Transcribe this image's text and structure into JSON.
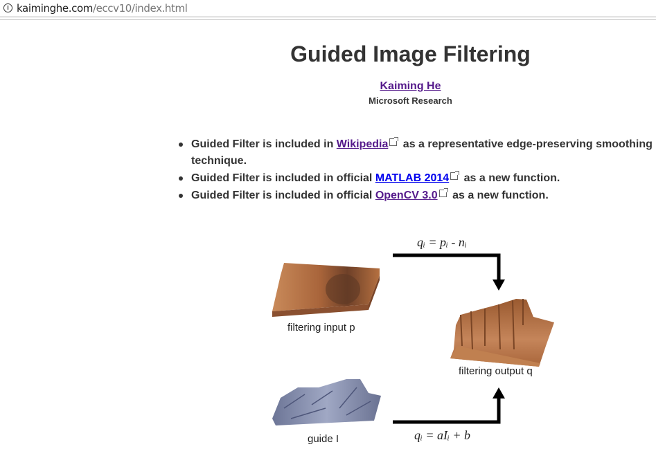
{
  "address_bar": {
    "host": "kaiminghe.com",
    "path": "/eccv10/index.html"
  },
  "page": {
    "title": "Guided Image Filtering",
    "author": "Kaiming He",
    "affiliation": "Microsoft Research",
    "bullets": [
      {
        "pre": "Guided Filter is included in ",
        "link": "Wikipedia",
        "post": " as a representative edge-preserving smoothing technique."
      },
      {
        "pre": "Guided Filter is included in official ",
        "link": "MATLAB 2014",
        "post": " as a new function."
      },
      {
        "pre": "Guided Filter is included in official ",
        "link": "OpenCV 3.0",
        "post": " as a new function."
      }
    ]
  },
  "diagram": {
    "input_label": "filtering input p",
    "output_label": "filtering output q",
    "guide_label": "guide I",
    "top_equation": "qᵢ = pᵢ - nᵢ",
    "bottom_equation": "qᵢ = aIᵢ + b"
  },
  "colors": {
    "visited_link": "#551a8b",
    "link": "#0000ee",
    "surface": "#b8703f",
    "guide": "#7d86a8"
  }
}
